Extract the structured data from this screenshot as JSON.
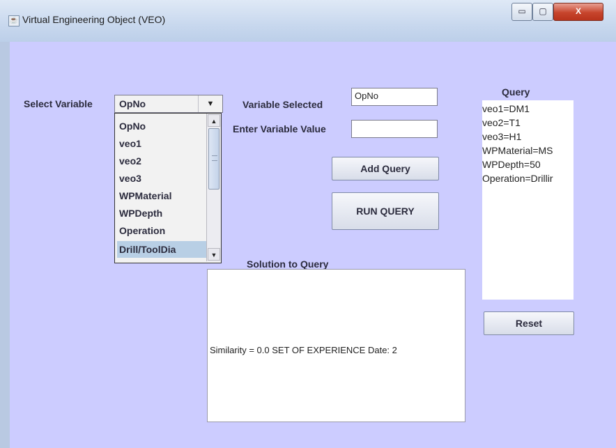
{
  "window": {
    "title": "Virtual Engineering Object (VEO)",
    "app_icon": "java-cup-icon"
  },
  "controls": {
    "minimize": "▭",
    "maximize": "▢",
    "close": "X"
  },
  "select_variable": {
    "label": "Select Variable",
    "value": "OpNo",
    "options": [
      "OpNo",
      "veo1",
      "veo2",
      "veo3",
      "WPMaterial",
      "WPDepth",
      "Operation",
      "Drill/ToolDia"
    ]
  },
  "variable_selected": {
    "label": "Variable Selected",
    "value": "OpNo"
  },
  "enter_value": {
    "label": "Enter Variable Value",
    "value": ""
  },
  "buttons": {
    "add_query": "Add Query",
    "run_query": "RUN QUERY",
    "reset": "Reset"
  },
  "query": {
    "title": "Query",
    "lines": [
      "veo1=DM1",
      "veo2=T1",
      "veo3=H1",
      "WPMaterial=MS",
      "WPDepth=50",
      "Operation=Drillir"
    ]
  },
  "solution": {
    "title": "Solution to Query",
    "text": "Similarity = 0.0   SET OF EXPERIENCE Date: 2"
  }
}
